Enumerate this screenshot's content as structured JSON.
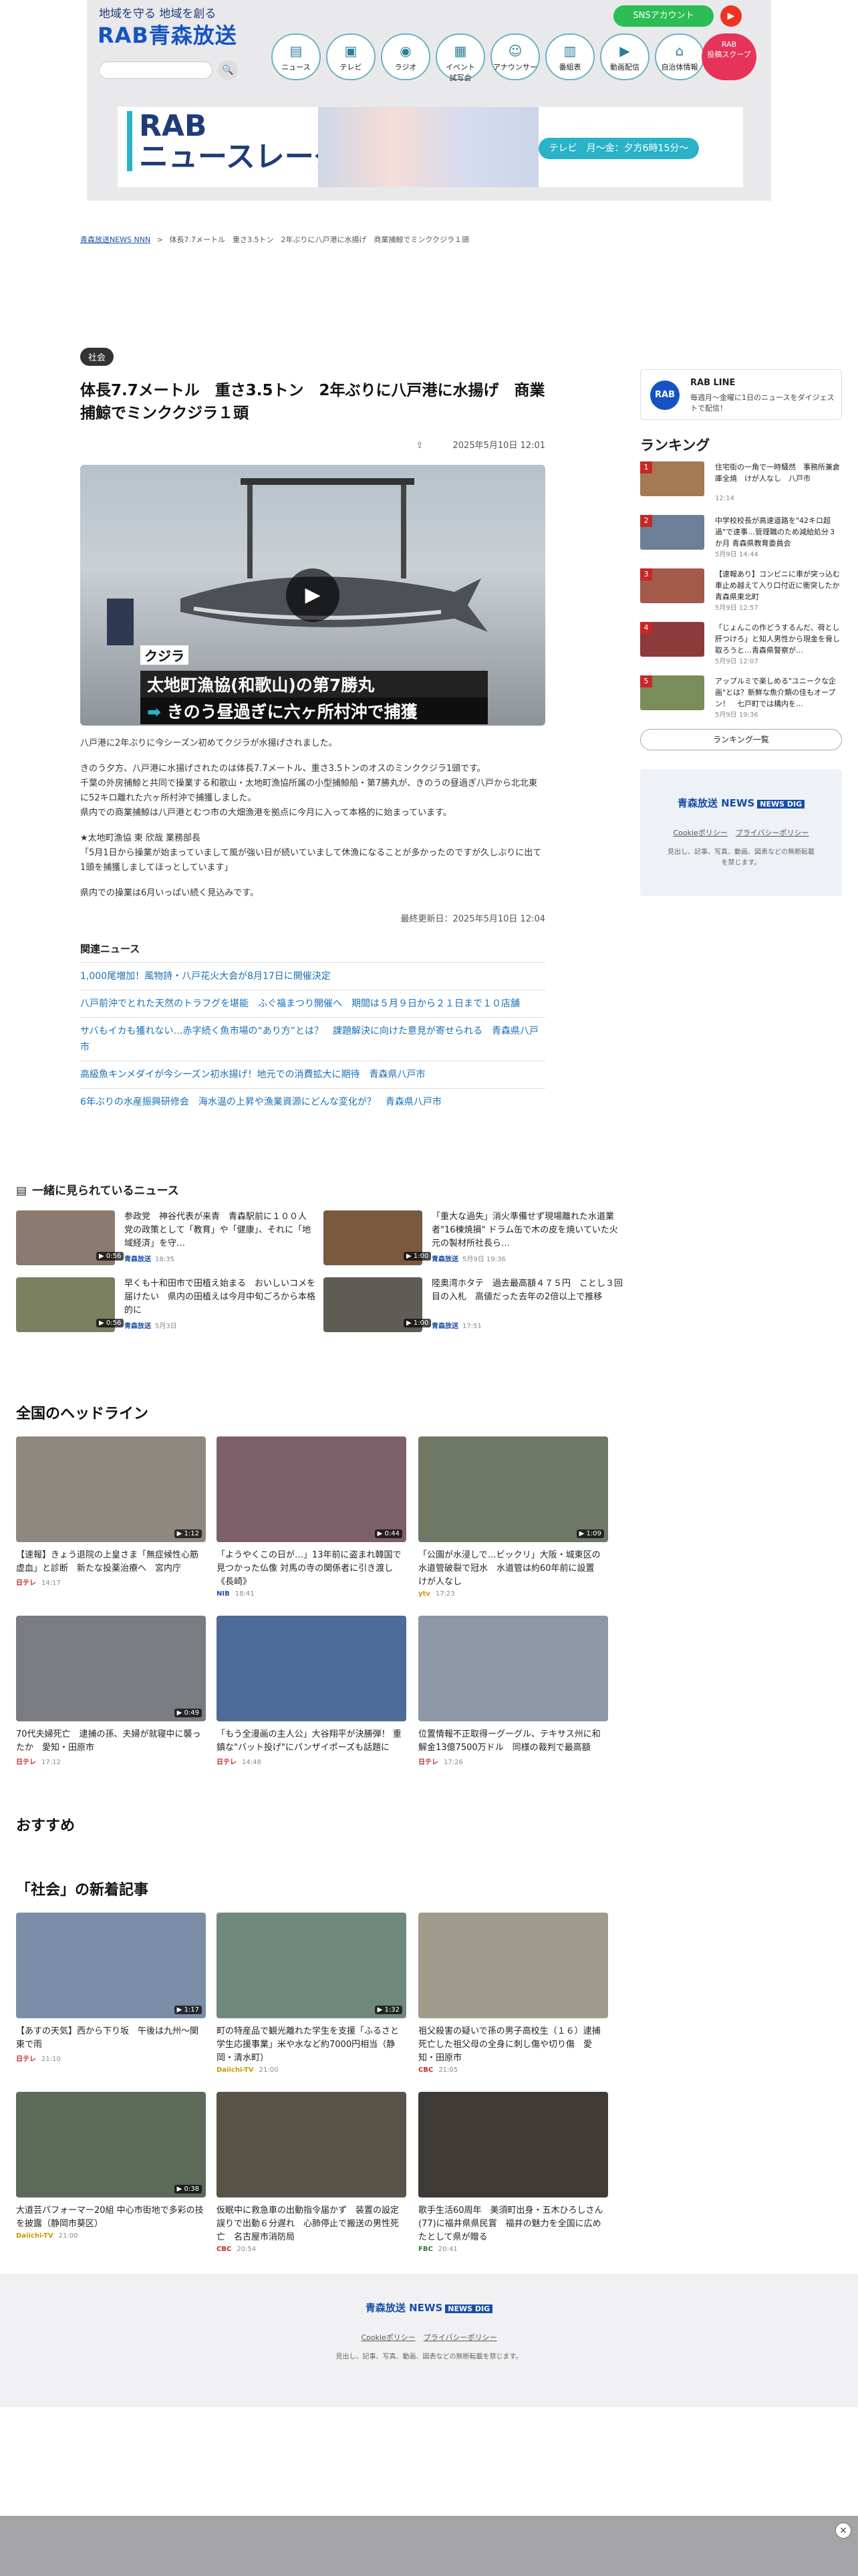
{
  "header": {
    "tagline": "地域を守る 地域を創る",
    "logo": "RAB青森放送",
    "search_icon": "🔍",
    "sns_button": "SNSアカウント",
    "youtube_icon": "▶",
    "nav": [
      {
        "label": "ニュース",
        "icon": "newspaper-icon",
        "glyph": "▤"
      },
      {
        "label": "テレビ",
        "icon": "tv-icon",
        "glyph": "▣"
      },
      {
        "label": "ラジオ",
        "icon": "radio-icon",
        "glyph": "◉"
      },
      {
        "label": "イベント\n試写会",
        "icon": "calendar-icon",
        "glyph": "▦"
      },
      {
        "label": "アナウンサー",
        "icon": "person-icon",
        "glyph": "☺"
      },
      {
        "label": "番組表",
        "icon": "table-icon",
        "glyph": "▥"
      },
      {
        "label": "動画配信",
        "icon": "video-icon",
        "glyph": "▶"
      },
      {
        "label": "自治体情報",
        "icon": "building-icon",
        "glyph": "⌂"
      }
    ],
    "scoop": "RAB\n投稿スクープ",
    "banner_title": "RAB\nニュースレーダー",
    "banner_time": "テレビ　月〜金：夕方6時15分〜"
  },
  "breadcrumb": {
    "home": "青森放送NEWS NNN",
    "sep": ">",
    "current": "体長7.7メートル　重さ3.5トン　2年ぶりに八戸港に水揚げ　商業捕鯨でミンククジラ１頭"
  },
  "article": {
    "category": "社会",
    "title": "体長7.7メートル　重さ3.5トン　2年ぶりに八戸港に水揚げ　商業捕鯨でミンククジラ１頭",
    "date": "2025年5月10日 12:01",
    "hero": {
      "label": "クジラ",
      "line1": "太地町漁協(和歌山)の第7勝丸",
      "line2_arrow": "➡",
      "line2": "きのう昼過ぎに六ヶ所村沖で捕獲"
    },
    "paragraphs": [
      "八戸港に2年ぶりに今シーズン初めてクジラが水揚げされました。",
      "きのう夕方、八戸港に水揚げされたのは体長7.7メートル、重さ3.5トンのオスのミンククジラ1頭です。\n千葉の外房捕鯨と共同で操業する和歌山・太地町漁協所属の小型捕鯨船・第7勝丸が、きのうの昼過ぎ八戸から北北東に52キロ離れた六ヶ所村沖で捕獲しました。\n県内での商業捕鯨は八戸港とむつ市の大畑漁港を拠点に今月に入って本格的に始まっています。",
      "★太地町漁協 東 欣哉 業務部長\n「5月1日から操業が始まっていまして風が強い日が続いていまして休漁になることが多かったのですが久しぶりに出て1頭を捕獲しましてほっとしています」",
      "県内での操業は6月いっぱい続く見込みです。"
    ],
    "updated": "最終更新日：2025年5月10日 12:04",
    "related_title": "関連ニュース",
    "related": [
      "1,000尾増加！風物詩・八戸花火大会が8月17日に開催決定",
      "八戸前沖でとれた天然のトラフグを堪能　ふぐ福まつり開催へ　期間は５月９日から２１日まで１０店舗",
      "サバもイカも獲れない…赤字続く魚市場の“あり方”とは？　課題解決に向けた意見が寄せられる　青森県八戸市",
      "高級魚キンメダイが今シーズン初水揚げ！地元での消費拡大に期待　青森県八戸市",
      "6年ぶりの水産振興研修会　海水温の上昇や漁業資源にどんな変化が？　青森県八戸市"
    ]
  },
  "together": {
    "title": "一緒に見られているニュース",
    "items": [
      {
        "title": "参政党　神谷代表が来青　青森駅前に１００人　党の政策として「教育」や「健康」、それに「地域経済」を守…",
        "source": "青森放送",
        "time": "18:35",
        "dur": "▶ 0:56",
        "color": "#8a7a6f"
      },
      {
        "title": "「重大な過失」消火準備せず現場離れた水道業者\"16棟焼損\" ドラム缶で木の皮を焼いていた火元の製材所社長ら…",
        "source": "青森放送",
        "time": "5月9日 19:36",
        "dur": "▶ 1:00",
        "color": "#7a5a3f"
      },
      {
        "title": "早くも十和田市で田植え始まる　おいしいコメを届けたい　県内の田植えは今月中旬ごろから本格的に",
        "source": "青森放送",
        "time": "5月3日",
        "dur": "▶ 0:56",
        "color": "#7b8061"
      },
      {
        "title": "陸奥湾ホタテ　過去最高額４７５円　ことし３回目の入札　高値だった去年の2倍以上で推移",
        "source": "青森放送",
        "time": "17:51",
        "dur": "▶ 1:00",
        "color": "#5e5c54"
      }
    ]
  },
  "sidebar": {
    "rabline_title": "RAB LINE",
    "rabline_desc": "毎週月〜金曜に1日のニュースをダイジェストで配信！",
    "ranking_title": "ランキング",
    "ranking": [
      {
        "title": "住宅街の一角で一時騒然　事務所兼倉庫全焼　けが人なし　八戸市",
        "time": "12:14",
        "color": "#a37a52"
      },
      {
        "title": "中学校校長が高速道路を\"42キロ超過\"で速事…管理職のため減給処分３か月 青森県教育委員会",
        "time": "5月9日 14:44",
        "color": "#6d7f96"
      },
      {
        "title": "【速報あり】コンビニに車が突っ込む　車止め越えて入り口付近に衝突したか　青森県東北町",
        "time": "5月9日 12:57",
        "color": "#a35a4a"
      },
      {
        "title": "「じょんこの作どうするんだ、荷とし肝つけろ」と知人男性から現金を脅し取ろうと…青森県警察が…",
        "time": "5月9日 12:07",
        "color": "#8c3a3a"
      },
      {
        "title": "アップルミで楽しめる\"ユニークな企画\"とは？新鮮な魚介類の佳もオープン！　七戸町では構内を…",
        "time": "5月9日 19:36",
        "color": "#7a8c5a"
      }
    ],
    "ranking_all": "ランキング一覧",
    "footer_logo": "青森放送",
    "footer_links": [
      "Cookieポリシー",
      "プライバシーポリシー"
    ],
    "footer_copy": "見出し、記事、写真、動画、図表などの無断転載を禁じます。"
  },
  "national": {
    "title": "全国のヘッドライン",
    "items": [
      {
        "title": "【速報】きょう退院の上皇さま「無症候性心筋虚血」と診断　新たな投薬治療へ　宮内庁",
        "source": "日テレ",
        "time": "14:17",
        "dur": "▶ 1:12",
        "color": "#8f8880",
        "srccolor": "#c62828"
      },
      {
        "title": "「ようやくこの日が…」13年前に盗まれ韓国で見つかった仏像 対馬の寺の関係者に引き渡し《長崎》",
        "source": "NIB",
        "time": "18:41",
        "dur": "▶ 0:44",
        "color": "#7d5f69",
        "srccolor": "#1a4ea8"
      },
      {
        "title": "「公園が水浸しで…ビックリ」大阪・城東区の水道管破裂で冠水　水道管は約60年前に設置　けが人なし",
        "source": "ytv",
        "time": "17:23",
        "dur": "▶ 1:09",
        "color": "#6e7864",
        "srccolor": "#c69a00"
      },
      {
        "title": "70代夫婦死亡　逮捕の孫、夫婦が就寝中に襲ったか　愛知・田原市",
        "source": "日テレ",
        "time": "17:12",
        "dur": "▶ 0:49",
        "color": "#7a7c82",
        "srccolor": "#c62828"
      },
      {
        "title": "「もう全漫画の主人公」大谷翔平が決勝弾！ 重鎮な\"バット投げ\"にパンザイポーズも話題に",
        "source": "日テレ",
        "time": "14:48",
        "dur": "",
        "color": "#4f6b9a",
        "srccolor": "#c62828"
      },
      {
        "title": "位置情報不正取得ーグーグル、テキサス州に和解金13億7500万ドル　同様の裁判で最高額",
        "source": "日テレ",
        "time": "17:26",
        "dur": "",
        "color": "#8d97a6",
        "srccolor": "#c62828"
      }
    ]
  },
  "osusume": {
    "title": "おすすめ"
  },
  "shakai": {
    "title": "「社会」の新着記事",
    "items": [
      {
        "title": "【あすの天気】西から下り坂　午後は九州〜関東で雨",
        "source": "日テレ",
        "time": "21:10",
        "dur": "▶ 1:17",
        "color": "#7c8da8",
        "srccolor": "#c62828"
      },
      {
        "title": "町の特産品で観光離れた学生を支援「ふるさと学生応援事業」米や水など約7000円相当（静岡・清水町）",
        "source": "Daiichi-TV",
        "time": "21:00",
        "dur": "▶ 1:32",
        "color": "#6f8a7c",
        "srccolor": "#c69a00"
      },
      {
        "title": "祖父殺害の疑いで孫の男子高校生（１６）逮捕　死亡した祖父母の全身に刺し傷や切り傷　愛知・田原市",
        "source": "CBC",
        "time": "21:05",
        "dur": "",
        "color": "#a09b8c",
        "srccolor": "#c62828"
      },
      {
        "title": "大道芸パフォーマー20組 中心市街地で多彩の技を披露（静岡市葵区）",
        "source": "Daiichi-TV",
        "time": "21:00",
        "dur": "▶ 0:38",
        "color": "#5d6a58",
        "srccolor": "#c69a00"
      },
      {
        "title": "仮眠中に救急車の出動指令届かず　装置の設定誤りで出動６分遅れ　心肺停止で搬送の男性死亡　名古屋市消防局",
        "source": "CBC",
        "time": "20:54",
        "dur": "",
        "color": "#5a5348",
        "srccolor": "#c62828"
      },
      {
        "title": "歌手生活60周年　美須町出身・五木ひろしさん(77)に福井県県民賞　福井の魅力を全国に広めたとして県が贈る",
        "source": "FBC",
        "time": "20:41",
        "dur": "",
        "color": "#3f3a36",
        "srccolor": "#2e7d32"
      }
    ]
  },
  "footer": {
    "logo": "青森放送",
    "digital": "NEWS DIG",
    "links": [
      "Cookieポリシー",
      "プライバシーポリシー"
    ],
    "copy": "見出し、記事、写真、動画、図表などの無断転載を禁じます。"
  },
  "ad": {
    "close": "×"
  }
}
